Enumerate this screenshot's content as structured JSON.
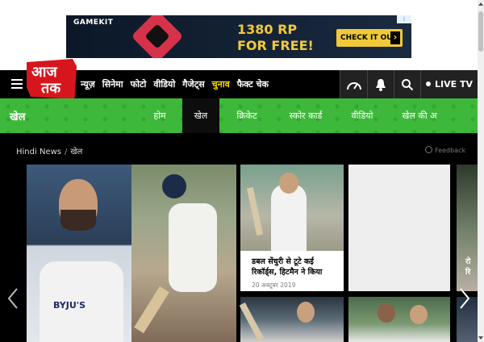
{
  "ad": {
    "brand": "GAMEKIT",
    "headline": "1380 RP",
    "subline": "FOR FREE!",
    "cta": "CHECK IT OUT",
    "choices_label": "i"
  },
  "logo": {
    "line1": "आज",
    "line2": "तक"
  },
  "nav": {
    "items": [
      "न्यूज़",
      "सिनेमा",
      "फोटो",
      "वीडियो",
      "गैजेट्स",
      "चुनाव",
      "फैक्ट चेक"
    ],
    "highlight_index": 5,
    "live_label": "LIVE TV"
  },
  "section": {
    "title": "खेल",
    "subnav": [
      "होम",
      "खेल",
      "क्रिकेट",
      "स्कोर कार्ड",
      "वीडियो",
      "खेल की अ"
    ],
    "active_index": 1
  },
  "breadcrumb": {
    "home": "Hindi News",
    "separator": "/",
    "current": "खेल"
  },
  "feedback": "Feedback",
  "hero": {
    "jersey_text": "BYJU'S"
  },
  "cards": [
    {
      "title": "डबल सेंचुरी से टूटे कई रिकॉर्ड्स, हिटमैन ने किया",
      "date": "20 अक्टूबर 2019"
    },
    {
      "partial_title": "रो\nरि"
    }
  ],
  "colors": {
    "accent_green": "#3db83a",
    "brand_red": "#d6161c",
    "highlight_yellow": "#ffd600"
  }
}
